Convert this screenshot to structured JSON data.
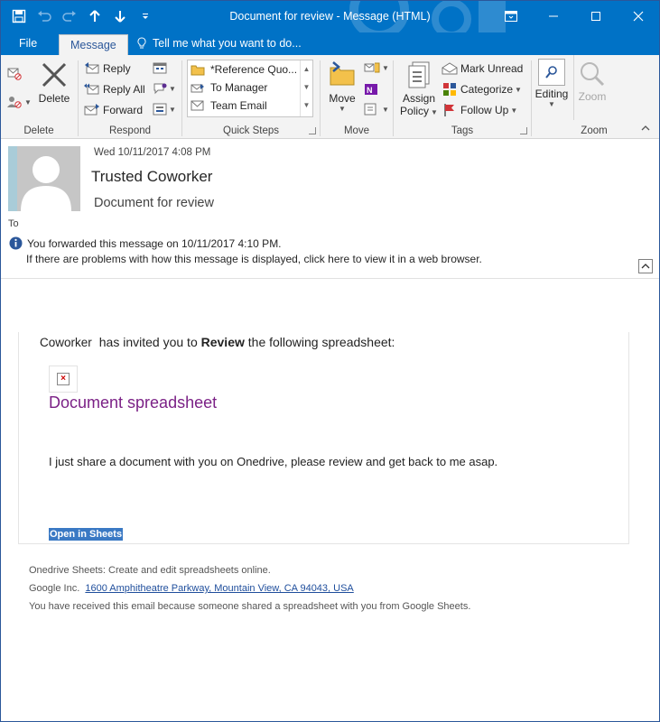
{
  "window": {
    "title": "Document for review - Message (HTML)"
  },
  "tabs": {
    "file": "File",
    "message": "Message",
    "tell_me": "Tell me what you want to do..."
  },
  "ribbon": {
    "delete_group": {
      "delete": "Delete",
      "label": "Delete"
    },
    "respond_group": {
      "reply": "Reply",
      "reply_all": "Reply All",
      "forward": "Forward",
      "label": "Respond"
    },
    "quick_steps": {
      "items": [
        "*Reference Quo...",
        "To Manager",
        "Team Email"
      ],
      "label": "Quick Steps"
    },
    "move_group": {
      "move": "Move",
      "label": "Move"
    },
    "tags_group": {
      "assign_policy_line1": "Assign",
      "assign_policy_line2": "Policy",
      "mark_unread": "Mark Unread",
      "categorize": "Categorize",
      "follow_up": "Follow Up",
      "label": "Tags"
    },
    "editing_group": {
      "editing": "Editing",
      "zoom": "Zoom",
      "label": "Zoom"
    }
  },
  "header": {
    "date": "Wed 10/11/2017 4:08 PM",
    "sender": "Trusted Coworker",
    "subject": "Document for review",
    "to": "To",
    "info_line1": "You forwarded this message on 10/11/2017 4:10 PM.",
    "info_line2": "If there are problems with how this message is displayed, click here to view it in a web browser."
  },
  "body": {
    "inviter": "Coworker",
    "invite_prefix": "has invited you to ",
    "invite_bold": "Review",
    "invite_suffix": " the following spreadsheet:",
    "doc_title": "Document spreadsheet",
    "message": "I just share a document with you on Onedrive, please review and get back to me asap.",
    "open_button": "Open in Sheets"
  },
  "footer": {
    "line1": "Onedrive Sheets: Create and edit spreadsheets online.",
    "company": "Google Inc.",
    "address": "1600 Amphitheatre Parkway, Mountain View, CA 94043, USA",
    "line3": "You have received this email because someone shared a spreadsheet with you from Google Sheets."
  },
  "colors": {
    "title_bar": "#0072c6",
    "doc_title": "#7b2186",
    "link": "#1f4e9c",
    "selection": "#3a79c4"
  }
}
